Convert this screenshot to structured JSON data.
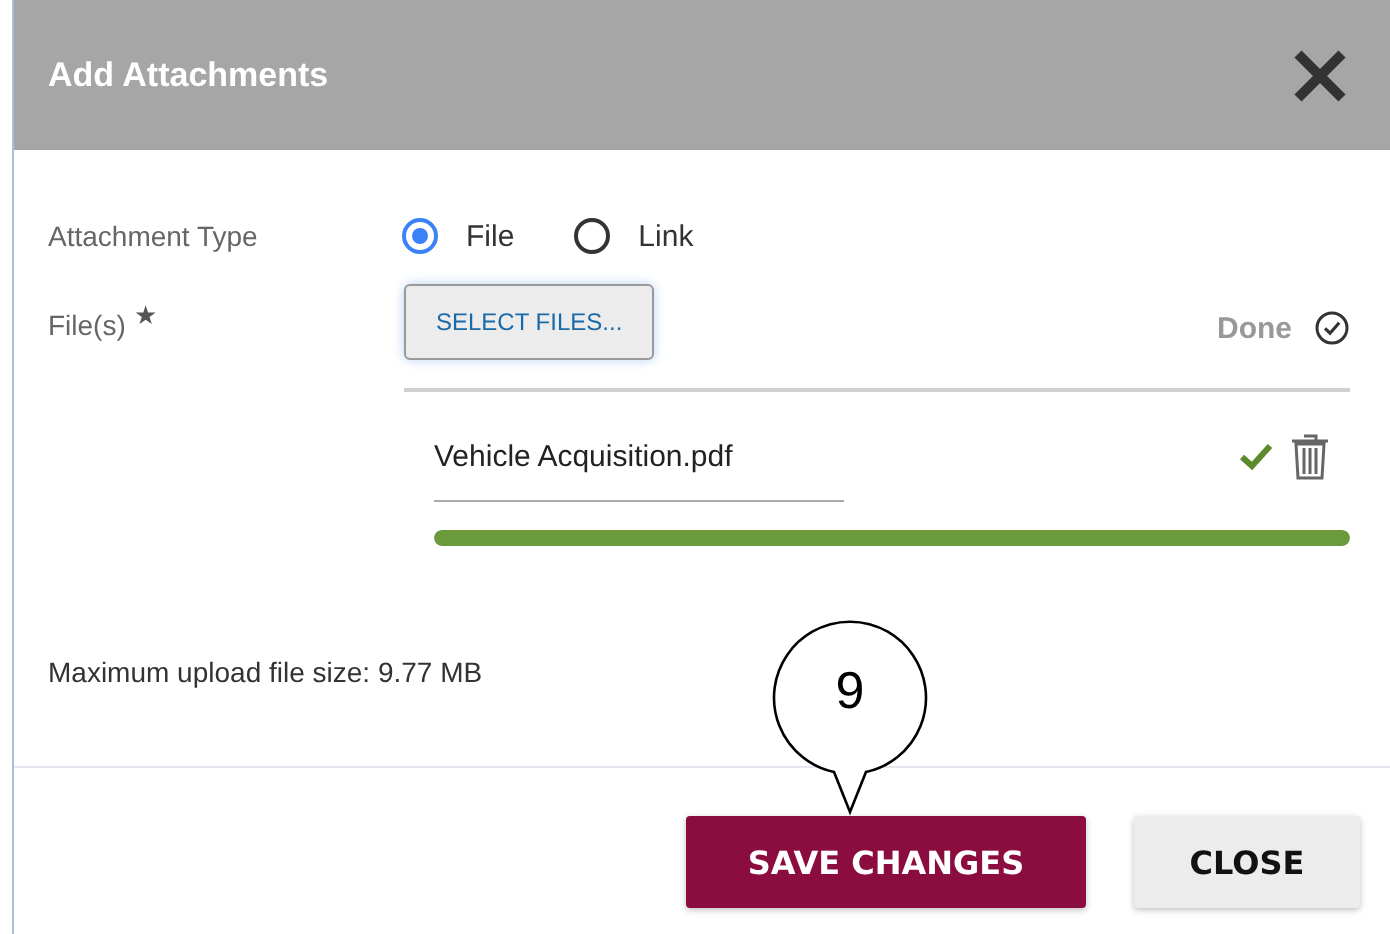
{
  "dialog": {
    "title": "Add Attachments"
  },
  "attachment_type": {
    "label": "Attachment Type",
    "options": [
      {
        "label": "File",
        "selected": true
      },
      {
        "label": "Link",
        "selected": false
      }
    ]
  },
  "files": {
    "label": "File(s)",
    "required_mark": "★",
    "select_button": "SELECT FILES...",
    "status_header": "Done",
    "items": [
      {
        "name": "Vehicle Acquisition.pdf",
        "level": 1
      }
    ]
  },
  "max_size_note": "Maximum upload file size: 9.77 MB",
  "buttons": [
    {
      "label": "SAVE CHANGES",
      "kind": "primary"
    },
    {
      "label": "CLOSE",
      "kind": "secondary"
    }
  ],
  "callout": {
    "number": "9"
  }
}
